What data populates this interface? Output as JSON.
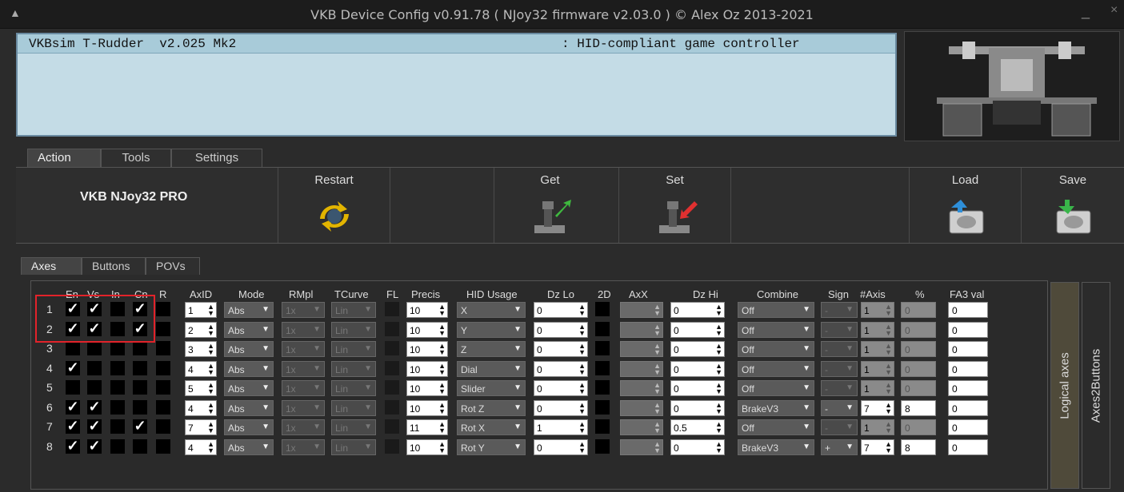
{
  "window": {
    "title": "VKB Device Config v0.91.78 ( NJoy32 firmware v2.03.0 ) © Alex Oz 2013-2021",
    "minimize": "_",
    "close": "×"
  },
  "device": {
    "name": "VKBsim T-Rudder  v2.025 Mk2",
    "type": ": HID-compliant game controller"
  },
  "main_tabs": [
    "Action",
    "Tools",
    "Settings"
  ],
  "brand": "VKB NJoy32 PRO",
  "actions": {
    "restart": "Restart",
    "get": "Get",
    "set": "Set",
    "load": "Load",
    "save": "Save"
  },
  "sub_tabs": [
    "Axes",
    "Buttons",
    "POVs"
  ],
  "columns": {
    "en": "En",
    "vs": "Vs",
    "in": "In",
    "cn": "Cn",
    "r": "R",
    "axid": "AxID",
    "mode": "Mode",
    "rmpl": "RMpl",
    "tcurve": "TCurve",
    "fl": "FL",
    "precis": "Precis",
    "hid": "HID Usage",
    "dzlo": "Dz Lo",
    "d2": "2D",
    "axx": "AxX",
    "dzhi": "Dz Hi",
    "combine": "Combine",
    "sign": "Sign",
    "naxis": "#Axis",
    "pct": "%",
    "fa3": "FA3 val"
  },
  "side_tabs": {
    "logical": "Logical axes",
    "a2b": "Axes2Buttons"
  },
  "rows": [
    {
      "n": "1",
      "en": "✓",
      "vs": "✓",
      "in": "",
      "cn": "✓",
      "axid": "1",
      "mode": "Abs",
      "rmpl": "1x",
      "tcurve": "Lin",
      "precis": "10",
      "hid": "X",
      "dzlo": "0",
      "dzhi": "0",
      "combine": "Off",
      "sign": "-",
      "naxis": "1",
      "pct": "0",
      "fa3": "0",
      "combine_active": false
    },
    {
      "n": "2",
      "en": "✓",
      "vs": "✓",
      "in": "",
      "cn": "✓",
      "axid": "2",
      "mode": "Abs",
      "rmpl": "1x",
      "tcurve": "Lin",
      "precis": "10",
      "hid": "Y",
      "dzlo": "0",
      "dzhi": "0",
      "combine": "Off",
      "sign": "-",
      "naxis": "1",
      "pct": "0",
      "fa3": "0",
      "combine_active": false
    },
    {
      "n": "3",
      "en": "",
      "vs": "",
      "in": "",
      "cn": "",
      "axid": "3",
      "mode": "Abs",
      "rmpl": "1x",
      "tcurve": "Lin",
      "precis": "10",
      "hid": "Z",
      "dzlo": "0",
      "dzhi": "0",
      "combine": "Off",
      "sign": "-",
      "naxis": "1",
      "pct": "0",
      "fa3": "0",
      "combine_active": false
    },
    {
      "n": "4",
      "en": "✓",
      "vs": "",
      "in": "",
      "cn": "",
      "axid": "4",
      "mode": "Abs",
      "rmpl": "1x",
      "tcurve": "Lin",
      "precis": "10",
      "hid": "Dial",
      "dzlo": "0",
      "dzhi": "0",
      "combine": "Off",
      "sign": "-",
      "naxis": "1",
      "pct": "0",
      "fa3": "0",
      "combine_active": false
    },
    {
      "n": "5",
      "en": "",
      "vs": "",
      "in": "",
      "cn": "",
      "axid": "5",
      "mode": "Abs",
      "rmpl": "1x",
      "tcurve": "Lin",
      "precis": "10",
      "hid": "Slider",
      "dzlo": "0",
      "dzhi": "0",
      "combine": "Off",
      "sign": "-",
      "naxis": "1",
      "pct": "0",
      "fa3": "0",
      "combine_active": false
    },
    {
      "n": "6",
      "en": "✓",
      "vs": "✓",
      "in": "",
      "cn": "",
      "axid": "4",
      "mode": "Abs",
      "rmpl": "1x",
      "tcurve": "Lin",
      "precis": "10",
      "hid": "Rot Z",
      "dzlo": "0",
      "dzhi": "0",
      "combine": "BrakeV3",
      "sign": "-",
      "naxis": "7",
      "pct": "8",
      "fa3": "0",
      "combine_active": true
    },
    {
      "n": "7",
      "en": "✓",
      "vs": "✓",
      "in": "",
      "cn": "✓",
      "axid": "7",
      "mode": "Abs",
      "rmpl": "1x",
      "tcurve": "Lin",
      "precis": "11",
      "hid": "Rot X",
      "dzlo": "1",
      "dzhi": "0.5",
      "combine": "Off",
      "sign": "-",
      "naxis": "1",
      "pct": "0",
      "fa3": "0",
      "combine_active": false
    },
    {
      "n": "8",
      "en": "✓",
      "vs": "✓",
      "in": "",
      "cn": "",
      "axid": "4",
      "mode": "Abs",
      "rmpl": "1x",
      "tcurve": "Lin",
      "precis": "10",
      "hid": "Rot Y",
      "dzlo": "0",
      "dzhi": "0",
      "combine": "BrakeV3",
      "sign": "+",
      "naxis": "7",
      "pct": "8",
      "fa3": "0",
      "combine_active": true
    }
  ]
}
